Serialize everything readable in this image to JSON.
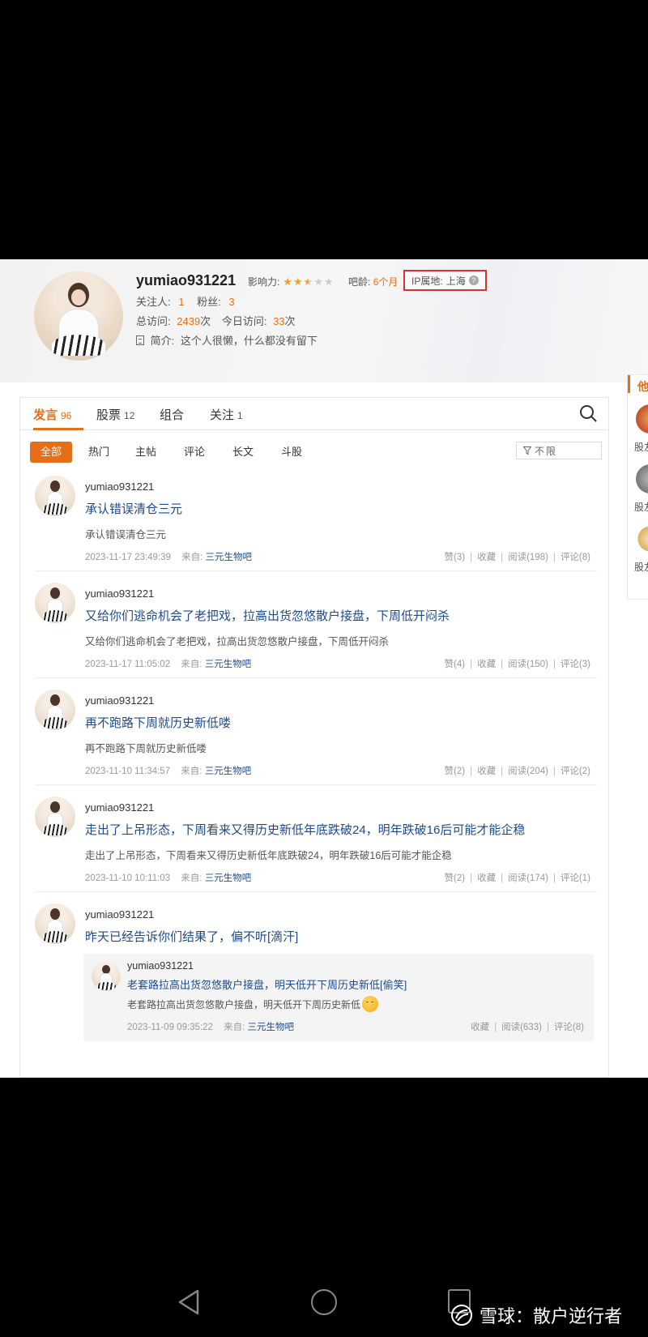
{
  "profile": {
    "username": "yumiao931221",
    "influence_label": "影响力:",
    "influence_stars": 2.5,
    "influence_max": 5,
    "bar_age_label": "吧龄:",
    "bar_age_value": "6个月",
    "ip_label": "IP属地:",
    "ip_value": "上海",
    "following_label": "关注人:",
    "following_count": "1",
    "fans_label": "粉丝:",
    "fans_count": "3",
    "total_visits_label": "总访问:",
    "total_visits": "2439",
    "visits_unit": "次",
    "today_visits_label": "今日访问:",
    "today_visits": "33",
    "bio_label": "简介:",
    "bio": "这个人很懒，什么都没有留下"
  },
  "tabs": [
    {
      "label": "发言",
      "count": "96",
      "active": true
    },
    {
      "label": "股票",
      "count": "12"
    },
    {
      "label": "组合",
      "count": ""
    },
    {
      "label": "关注",
      "count": "1"
    }
  ],
  "filters": [
    "全部",
    "热门",
    "主帖",
    "评论",
    "长文",
    "斗股"
  ],
  "limit_label": "不限",
  "posts": [
    {
      "author": "yumiao931221",
      "title": "承认错误清仓三元",
      "excerpt": "承认错误清仓三元",
      "time": "2023-11-17 23:49:39",
      "source_label": "来自:",
      "source": "三元生物吧",
      "likes": "赞(3)",
      "fav": "收藏",
      "reads": "阅读(198)",
      "comments": "评论(8)"
    },
    {
      "author": "yumiao931221",
      "title": "又给你们逃命机会了老把戏，拉高出货忽悠散户接盘，下周低开闷杀",
      "excerpt": "又给你们逃命机会了老把戏，拉高出货忽悠散户接盘，下周低开闷杀",
      "time": "2023-11-17 11:05:02",
      "source_label": "来自:",
      "source": "三元生物吧",
      "likes": "赞(4)",
      "fav": "收藏",
      "reads": "阅读(150)",
      "comments": "评论(3)"
    },
    {
      "author": "yumiao931221",
      "title": "再不跑路下周就历史新低喽",
      "excerpt": "再不跑路下周就历史新低喽",
      "time": "2023-11-10 11:34:57",
      "source_label": "来自:",
      "source": "三元生物吧",
      "likes": "赞(2)",
      "fav": "收藏",
      "reads": "阅读(204)",
      "comments": "评论(2)"
    },
    {
      "author": "yumiao931221",
      "title": "走出了上吊形态，下周看来又得历史新低年底跌破24，明年跌破16后可能才能企稳",
      "excerpt": "走出了上吊形态，下周看来又得历史新低年底跌破24，明年跌破16后可能才能企稳",
      "time": "2023-11-10 10:11:03",
      "source_label": "来自:",
      "source": "三元生物吧",
      "likes": "赞(2)",
      "fav": "收藏",
      "reads": "阅读(174)",
      "comments": "评论(1)"
    },
    {
      "author": "yumiao931221",
      "title": "昨天已经告诉你们结果了，偏不听[滴汗]",
      "quote": {
        "author": "yumiao931221",
        "title": "老套路拉高出货忽悠散户接盘，明天低开下周历史新低[偷笑]",
        "text": "老套路拉高出货忽悠散户接盘，明天低开下周历史新低",
        "time": "2023-11-09 09:35:22",
        "source_label": "来自:",
        "source": "三元生物吧",
        "fav": "收藏",
        "reads": "阅读(633)",
        "comments": "评论(8)"
      }
    }
  ],
  "sidebar": {
    "header": "他",
    "items": [
      "股友",
      "股友",
      "股友"
    ]
  },
  "watermark": "雪球：散户逆行者",
  "colors": {
    "accent": "#e46f18",
    "link": "#1e4a8c",
    "highlight_box": "#d8322e"
  }
}
